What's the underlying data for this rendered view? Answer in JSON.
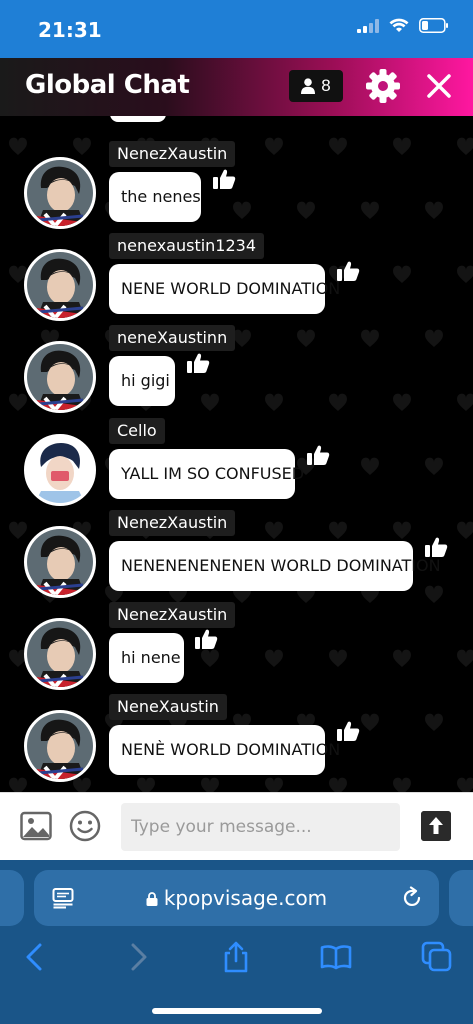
{
  "status": {
    "time": "21:31"
  },
  "header": {
    "title": "Global Chat",
    "user_count": "8"
  },
  "messages": [
    {
      "username": "NenezXaustin",
      "text": "the nenes",
      "avatar": "boy"
    },
    {
      "username": "nenexaustin1234",
      "text": "NENE WORLD DOMINATION",
      "avatar": "boy"
    },
    {
      "username": "neneXaustinn",
      "text": "hi gigi",
      "avatar": "boy"
    },
    {
      "username": "Cello",
      "text": "YALL IM SO CONFUSED",
      "avatar": "cello"
    },
    {
      "username": "NenezXaustin",
      "text": "NENENENENENEN WORLD DOMINATION",
      "avatar": "boy"
    },
    {
      "username": "NenezXaustin",
      "text": "hi nene",
      "avatar": "boy"
    },
    {
      "username": "NeneXaustin",
      "text": "NENÈ WORLD DOMINATION",
      "avatar": "boy"
    }
  ],
  "input": {
    "placeholder": "Type your message..."
  },
  "browser": {
    "url": "kpopvisage.com"
  },
  "colors": {
    "status_bar": "#1f7fd6",
    "header_accent": "#ff17a0",
    "browser_bg": "#1a5588",
    "browser_accent": "#2f8dff"
  }
}
